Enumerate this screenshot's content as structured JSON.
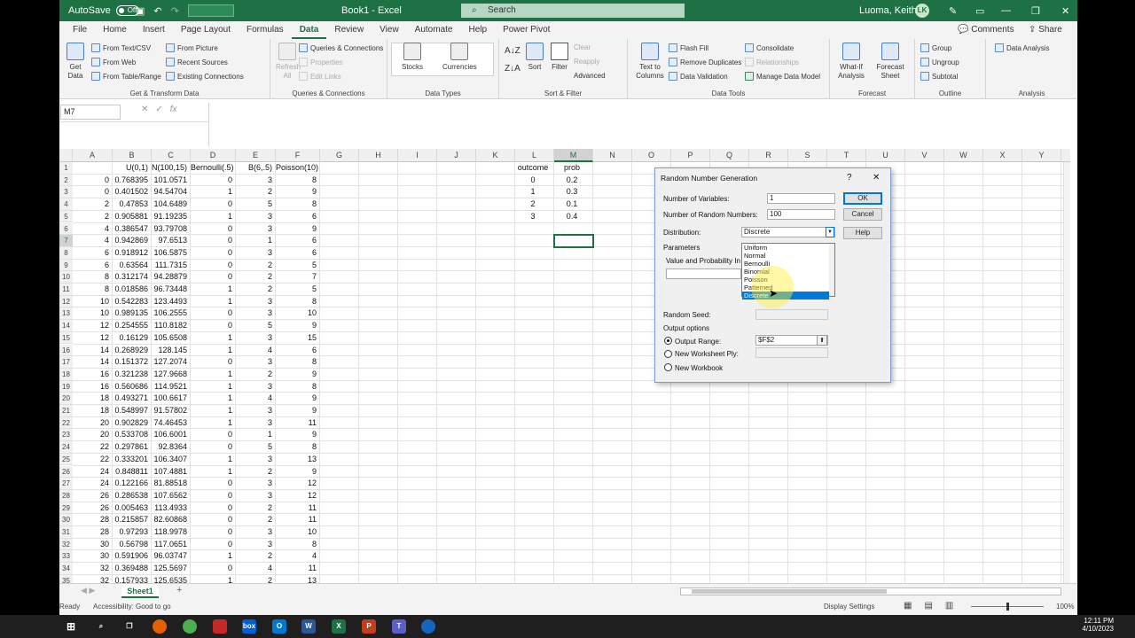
{
  "titlebar": {
    "autosave": "AutoSave",
    "toggle": "Off",
    "doc": "Book1 - Excel",
    "search": "Search",
    "user": "Luoma, Keith E.",
    "initials": "LK"
  },
  "menu": [
    "File",
    "Home",
    "Insert",
    "Page Layout",
    "Formulas",
    "Data",
    "Review",
    "View",
    "Automate",
    "Help",
    "Power Pivot"
  ],
  "menu_right": {
    "comments": "Comments",
    "share": "Share"
  },
  "ribbon": {
    "get_data": "Get Data",
    "from_text": "From Text/CSV",
    "from_web": "From Web",
    "from_table": "From Table/Range",
    "from_picture": "From Picture",
    "recent_sources": "Recent Sources",
    "existing_conn": "Existing Connections",
    "group1": "Get & Transform Data",
    "refresh_all": "Refresh All",
    "queries_conn": "Queries & Connections",
    "properties": "Properties",
    "edit_links": "Edit Links",
    "group2": "Queries & Connections",
    "stocks": "Stocks",
    "currencies": "Currencies",
    "group3": "Data Types",
    "sort": "Sort",
    "filter": "Filter",
    "clear": "Clear",
    "reapply": "Reapply",
    "advanced": "Advanced",
    "group4": "Sort & Filter",
    "text_to_columns": "Text to Columns",
    "flash_fill": "Flash Fill",
    "remove_dup": "Remove Duplicates",
    "data_validation": "Data Validation",
    "consolidate": "Consolidate",
    "relationships": "Relationships",
    "manage_model": "Manage Data Model",
    "group5": "Data Tools",
    "what_if": "What-If Analysis",
    "forecast_sheet": "Forecast Sheet",
    "group6": "Forecast",
    "group_btn": "Group",
    "ungroup": "Ungroup",
    "subtotal": "Subtotal",
    "group7": "Outline",
    "data_analysis": "Data Analysis",
    "group8": "Analysis"
  },
  "formula_bar": {
    "namebox": "M7",
    "fx": "fx"
  },
  "columns": [
    "A",
    "B",
    "C",
    "D",
    "E",
    "F",
    "G",
    "H",
    "I",
    "J",
    "K",
    "L",
    "M",
    "N",
    "O",
    "P",
    "Q",
    "R",
    "S",
    "T",
    "U",
    "V",
    "W",
    "X",
    "Y"
  ],
  "row_numbers": [
    "1",
    "2",
    "3",
    "4",
    "5",
    "6",
    "7",
    "8",
    "9",
    "10",
    "11",
    "12",
    "13",
    "14",
    "15",
    "16",
    "17",
    "18",
    "19",
    "20",
    "21",
    "22",
    "23",
    "24",
    "25",
    "26",
    "27",
    "28",
    "29",
    "30",
    "31",
    "32",
    "33",
    "34",
    "35"
  ],
  "headers": {
    "B": "U(0,1)",
    "C": "N(100,15)",
    "D": "Bernoulli(.5)",
    "E": "B(6,.5)",
    "F": "Poisson(10)",
    "L": "outcome",
    "M": "prob"
  },
  "rows": [
    [
      "0",
      "0.768395",
      "101.0571",
      "0",
      "3",
      "8"
    ],
    [
      "0",
      "0.401502",
      "94.54704",
      "1",
      "2",
      "9"
    ],
    [
      "2",
      "0.47853",
      "104.6489",
      "0",
      "5",
      "8"
    ],
    [
      "2",
      "0.905881",
      "91.19235",
      "1",
      "3",
      "6"
    ],
    [
      "4",
      "0.386547",
      "93.79708",
      "0",
      "3",
      "9"
    ],
    [
      "4",
      "0.942869",
      "97.6513",
      "0",
      "1",
      "6"
    ],
    [
      "6",
      "0.918912",
      "106.5875",
      "0",
      "3",
      "6"
    ],
    [
      "6",
      "0.63564",
      "111.7315",
      "0",
      "2",
      "5"
    ],
    [
      "8",
      "0.312174",
      "94.28879",
      "0",
      "2",
      "7"
    ],
    [
      "8",
      "0.018586",
      "96.73448",
      "1",
      "2",
      "5"
    ],
    [
      "10",
      "0.542283",
      "123.4493",
      "1",
      "3",
      "8"
    ],
    [
      "10",
      "0.989135",
      "106.2555",
      "0",
      "3",
      "10"
    ],
    [
      "12",
      "0.254555",
      "110.8182",
      "0",
      "5",
      "9"
    ],
    [
      "12",
      "0.16129",
      "105.6508",
      "1",
      "3",
      "15"
    ],
    [
      "14",
      "0.268929",
      "128.145",
      "1",
      "4",
      "6"
    ],
    [
      "14",
      "0.151372",
      "127.2074",
      "0",
      "3",
      "8"
    ],
    [
      "16",
      "0.321238",
      "127.9668",
      "1",
      "2",
      "9"
    ],
    [
      "16",
      "0.560686",
      "114.9521",
      "1",
      "3",
      "8"
    ],
    [
      "18",
      "0.493271",
      "100.6617",
      "1",
      "4",
      "9"
    ],
    [
      "18",
      "0.548997",
      "91.57802",
      "1",
      "3",
      "9"
    ],
    [
      "20",
      "0.902829",
      "74.46453",
      "1",
      "3",
      "11"
    ],
    [
      "20",
      "0.533708",
      "106.6001",
      "0",
      "1",
      "9"
    ],
    [
      "22",
      "0.297861",
      "92.8364",
      "0",
      "5",
      "8"
    ],
    [
      "22",
      "0.333201",
      "106.3407",
      "1",
      "3",
      "13"
    ],
    [
      "24",
      "0.848811",
      "107.4881",
      "1",
      "2",
      "9"
    ],
    [
      "24",
      "0.122166",
      "81.88518",
      "0",
      "3",
      "12"
    ],
    [
      "26",
      "0.286538",
      "107.6562",
      "0",
      "3",
      "12"
    ],
    [
      "26",
      "0.005463",
      "113.4933",
      "0",
      "2",
      "11"
    ],
    [
      "28",
      "0.215857",
      "82.60868",
      "0",
      "2",
      "11"
    ],
    [
      "28",
      "0.97293",
      "118.9978",
      "0",
      "3",
      "10"
    ],
    [
      "30",
      "0.56798",
      "117.0651",
      "0",
      "3",
      "8"
    ],
    [
      "30",
      "0.591906",
      "96.03747",
      "1",
      "2",
      "4"
    ],
    [
      "32",
      "0.369488",
      "125.5697",
      "0",
      "4",
      "11"
    ],
    [
      "32",
      "0.157933",
      "125.6535",
      "1",
      "2",
      "13"
    ]
  ],
  "lm_table": [
    [
      "0",
      "0.2"
    ],
    [
      "1",
      "0.3"
    ],
    [
      "2",
      "0.1"
    ],
    [
      "3",
      "0.4"
    ]
  ],
  "sheet": {
    "tab": "Sheet1",
    "add": "+"
  },
  "status": {
    "ready": "Ready",
    "accessibility": "Accessibility: Good to go",
    "display": "Display Settings",
    "zoom": "100%"
  },
  "dialog": {
    "title": "Random Number Generation",
    "help_q": "?",
    "close": "✕",
    "num_vars_label": "Number of Variables:",
    "num_vars": "1",
    "num_rand_label": "Number of Random Numbers:",
    "num_rand": "100",
    "dist_label": "Distribution:",
    "dist_value": "Discrete",
    "params_label": "Parameters",
    "vp_label": "Value and Probability In",
    "options": [
      "Uniform",
      "Normal",
      "Bernoulli",
      "Binomial",
      "Poisson",
      "Patterned",
      "Discrete"
    ],
    "seed_label": "Random Seed:",
    "output_options": "Output options",
    "output_range": "Output Range:",
    "output_range_value": "$F$2",
    "new_ply": "New Worksheet Ply:",
    "new_workbook": "New Workbook",
    "ok": "OK",
    "cancel": "Cancel",
    "help": "Help"
  },
  "taskbar": {
    "time": "12:11 PM",
    "date": "4/10/2023"
  }
}
